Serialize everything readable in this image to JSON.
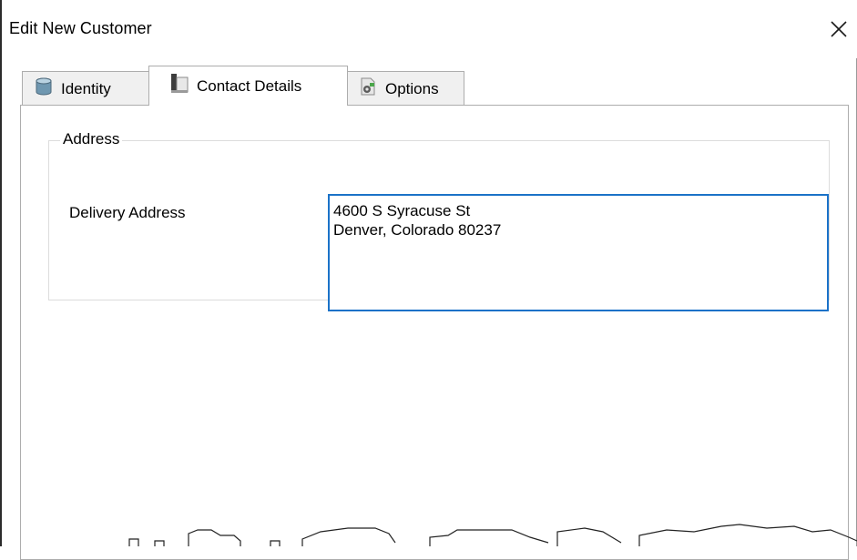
{
  "window": {
    "title": "Edit New Customer"
  },
  "tabs": [
    {
      "label": "Identity",
      "icon": "database-icon",
      "selected": false
    },
    {
      "label": "Contact Details",
      "icon": "contact-card-icon",
      "selected": true
    },
    {
      "label": "Options",
      "icon": "settings-document-icon",
      "selected": false
    }
  ],
  "address_group": {
    "title": "Address",
    "delivery_label": "Delivery Address",
    "delivery_lines": [
      "4600 S Syracuse St",
      "Denver, Colorado 80237"
    ]
  },
  "colors": {
    "focus_border": "#1b72c8",
    "tab_background": "#f0f0f0",
    "border": "#adadad"
  }
}
